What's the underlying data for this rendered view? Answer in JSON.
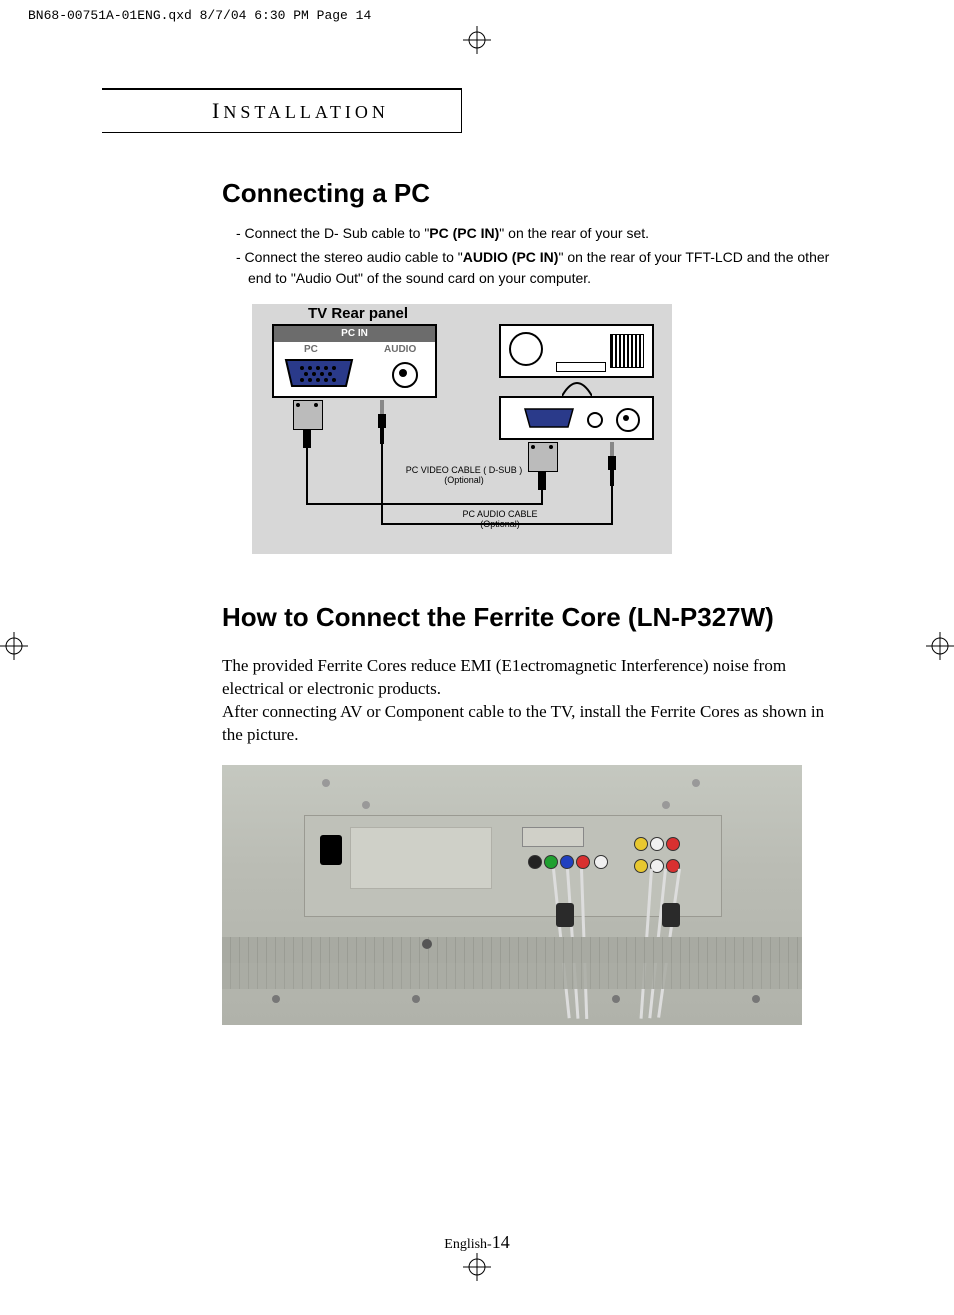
{
  "slug": "BN68-00751A-01ENG.qxd  8/7/04 6:30 PM  Page 14",
  "section_header": "NSTALLATION",
  "section_header_cap": "I",
  "title1": "Connecting a PC",
  "bullets": {
    "b1_pre": "-  Connect the D- Sub cable  to \"",
    "b1_bold": "PC (PC IN)",
    "b1_post": "\" on the rear of your set.",
    "b2_pre": "-  Connect the stereo audio cable  to \"",
    "b2_bold": "AUDIO (PC IN)",
    "b2_post": "\" on the rear of your TFT-LCD and the other end to \"Audio Out\" of the sound card on your computer."
  },
  "diagram": {
    "rear_label": "TV Rear panel",
    "pc_in": "PC IN",
    "pc": "PC",
    "audio": "AUDIO",
    "video_cable": "PC VIDEO CABLE ( D-SUB )",
    "optional": "(Optional)",
    "audio_cable": "PC AUDIO CABLE"
  },
  "title2": "How to Connect the Ferrite Core (LN-P327W)",
  "para1": "The provided Ferrite Cores reduce EMI (E1ectromagnetic Interference) noise from electrical or electronic products.",
  "para2": "After connecting AV or Component cable to the TV, install the Ferrite Cores as shown in the picture.",
  "footer_lang": "English-",
  "footer_page": "14"
}
